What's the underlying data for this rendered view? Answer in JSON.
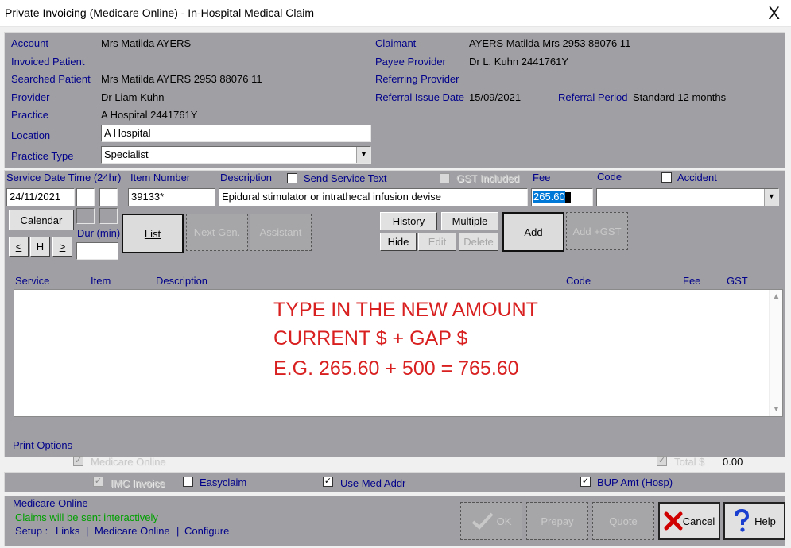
{
  "window": {
    "title": "Private Invoicing (Medicare Online) - In-Hospital Medical Claim",
    "close_glyph": "X"
  },
  "header": {
    "account_label": "Account",
    "account_value": "Mrs Matilda AYERS",
    "invoiced_patient_label": "Invoiced Patient",
    "searched_patient_label": "Searched Patient",
    "searched_patient_value": "Mrs Matilda AYERS 2953 88076 11",
    "provider_label": "Provider",
    "provider_value": "Dr Liam Kuhn",
    "practice_label": "Practice",
    "practice_value": "A Hospital 2441761Y",
    "location_label": "Location",
    "location_value": "A Hospital",
    "practice_type_label": "Practice Type",
    "practice_type_value": "Specialist",
    "claimant_label": "Claimant",
    "claimant_value": "AYERS Matilda Mrs 2953 88076 11",
    "payee_provider_label": "Payee Provider",
    "payee_provider_value": "Dr L. Kuhn 2441761Y",
    "referring_provider_label": "Referring Provider",
    "referral_issue_date_label": "Referral Issue Date",
    "referral_issue_date_value": "15/09/2021",
    "referral_period_label": "Referral Period",
    "referral_period_value": "Standard 12 months"
  },
  "service": {
    "date_time_label": "Service Date Time (24hr)",
    "item_number_label": "Item Number",
    "description_label": "Description",
    "send_service_text_label": "Send Service Text",
    "gst_included_label": "GST Included",
    "fee_label": "Fee",
    "code_label": "Code",
    "accident_label": "Accident",
    "date_value": "24/11/2021",
    "item_value": "39133*",
    "description_value": "Epidural stimulator or intrathecal infusion devise",
    "fee_value": "265.60",
    "dur_label": "Dur (min)"
  },
  "buttons": {
    "calendar": "Calendar",
    "prev": "<",
    "h": "H",
    "next": ">",
    "list": "List",
    "next_gen": "Next Gen.",
    "assistant": "Assistant",
    "history": "History",
    "multiple": "Multiple",
    "hide": "Hide",
    "edit": "Edit",
    "delete": "Delete",
    "add": "Add",
    "add_gst": "Add +GST",
    "ok": "OK",
    "prepay": "Prepay",
    "quote": "Quote",
    "cancel": "Cancel",
    "help": "Help"
  },
  "list": {
    "columns": [
      "Service",
      "Item",
      "Description",
      "Code",
      "Fee",
      "GST"
    ],
    "note_lines": [
      "TYPE IN THE NEW AMOUNT",
      "CURRENT $ + GAP $",
      "E.G. 265.60 + 500 = 765.60"
    ]
  },
  "print_options": {
    "label": "Print Options",
    "medicare_online": "Medicare Online",
    "total_label": "Total $",
    "total_value": "0.00",
    "imc_invoice": "IMC Invoice",
    "easyclaim": "Easyclaim",
    "use_med_addr": "Use Med Addr",
    "bup_amt": "BUP Amt (Hosp)"
  },
  "footer": {
    "medicare_online_label": "Medicare Online",
    "status": "Claims will be sent interactively",
    "setup_label": "Setup :",
    "links": "Links",
    "medicare_online_link": "Medicare Online",
    "configure": "Configure",
    "sep": "|"
  },
  "colors": {
    "panel": "#a0a0a4",
    "label_blue": "#00008b",
    "note_red": "#d92020",
    "status_green": "#00a000"
  }
}
